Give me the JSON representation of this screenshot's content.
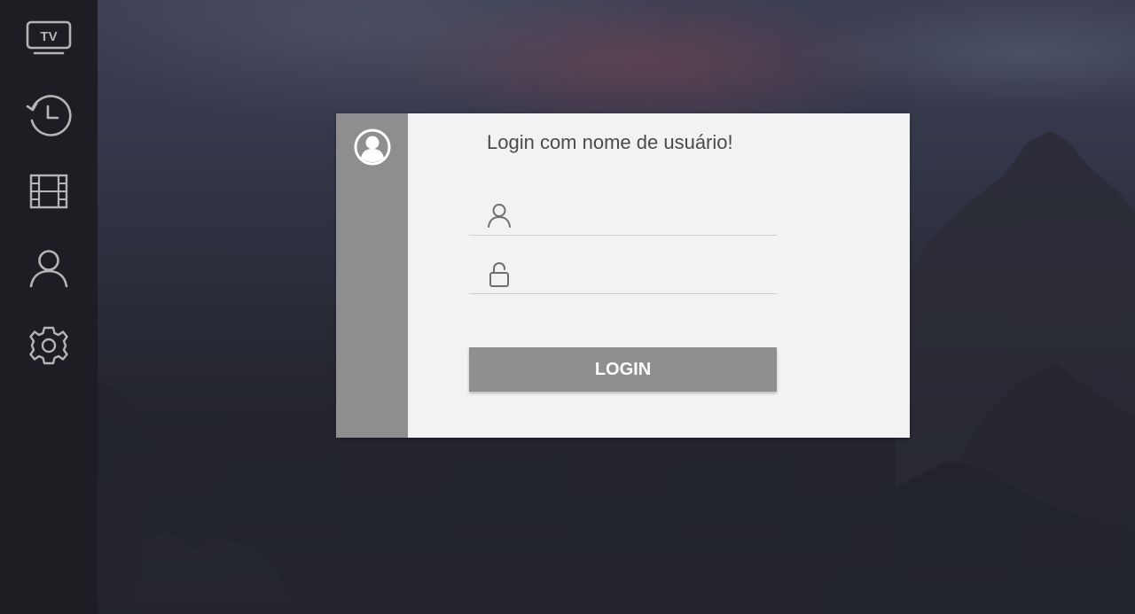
{
  "sidebar": {
    "items": [
      {
        "id": "tv",
        "icon": "tv-icon",
        "text": "TV"
      },
      {
        "id": "history",
        "icon": "history-clock-icon"
      },
      {
        "id": "movies",
        "icon": "film-strip-icon"
      },
      {
        "id": "profile",
        "icon": "user-icon"
      },
      {
        "id": "settings",
        "icon": "gear-icon"
      }
    ],
    "icon_color": "#b5b5b5",
    "background": "#1d1e24"
  },
  "login": {
    "title": "Login com nome de usuário!",
    "username": {
      "value": "",
      "placeholder": "",
      "icon": "user-icon"
    },
    "password": {
      "value": "",
      "placeholder": "",
      "icon": "unlock-icon"
    },
    "button_label": "LOGIN",
    "avatar_icon": "user-circle-icon"
  },
  "colors": {
    "card_background": "#f2f2f2",
    "card_side": "#8e8e8e",
    "button": "#8f8f8f",
    "title_text": "#4a4a4a"
  }
}
